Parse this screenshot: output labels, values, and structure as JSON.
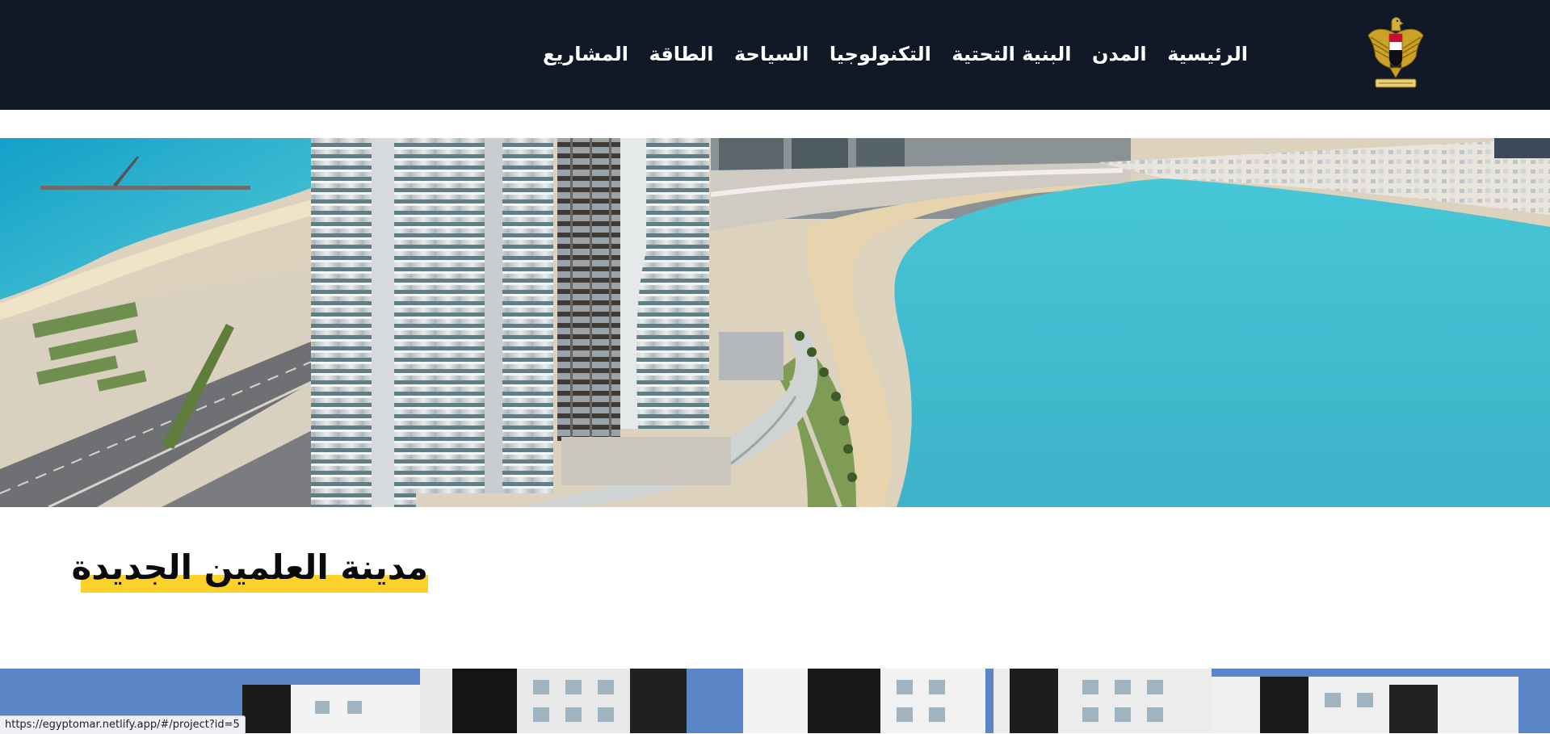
{
  "nav": {
    "items": [
      {
        "label": "الرئيسية"
      },
      {
        "label": "المدن"
      },
      {
        "label": "البنية التحتية"
      },
      {
        "label": "التكنولوجيا"
      },
      {
        "label": "السياحة"
      },
      {
        "label": "الطاقة"
      },
      {
        "label": "المشاريع"
      }
    ],
    "logo_icon": "egyptian-eagle-emblem"
  },
  "hero": {
    "image": "new-alamein-city-towers-and-lagoon"
  },
  "project": {
    "title": "مدينة العلمين الجديدة"
  },
  "gallery": {
    "image": "residential-buildings"
  },
  "status_bar": {
    "url": "https://egyptomar.netlify.app/#/project?id=5"
  },
  "colors": {
    "nav_background": "#111827",
    "title_highlight": "#fcd12a",
    "nav_text": "#ffffff"
  }
}
